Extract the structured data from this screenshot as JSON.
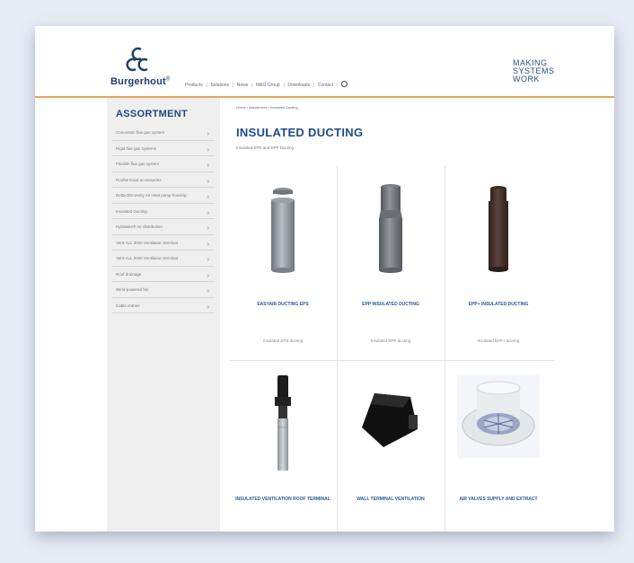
{
  "header": {
    "brand": "Burgerhout",
    "brand_mark": "®",
    "nav": [
      "Products",
      "Solutions",
      "News",
      "M&G Group",
      "Downloads",
      "Contact"
    ],
    "slogan": [
      "MAKING",
      "SYSTEMS",
      "WORK"
    ]
  },
  "sidebar": {
    "title": "ASSORTMENT",
    "items": [
      "Concentric flue gas system",
      "Rigid flue gas systems",
      "Flexible flue gas system",
      "Roofterminal accessories",
      "Delta-Discovery Air Heat pump housing",
      "Insulated Ducting",
      "Hybalaire® Air distribution",
      "Vent-ALL 3000 Ventilation terminal",
      "Vent-ALL 2000 Ventilation terminal",
      "Roof drainage",
      "Wind-powered fan",
      "Cable entries"
    ]
  },
  "breadcrumb": "Home › Assortment › Insulated Ducting",
  "page": {
    "title": "INSULATED DUCTING",
    "subtitle": "Insulated EPS and EPP Ducting"
  },
  "products": [
    {
      "name": "EASYAIR DUCTING EPS",
      "desc": "Insulated EPS ducting",
      "icon": "grey-duct-image"
    },
    {
      "name": "EPP INSULATED DUCTING",
      "desc": "Insulated EPP ducting",
      "icon": "dark-grey-duct-image"
    },
    {
      "name": "EPP+ INSULATED DUCTING",
      "desc": "Insulated EPP+ ducting",
      "icon": "brown-duct-image"
    },
    {
      "name": "INSULATED VENTILATION ROOF TERMINAL",
      "desc": "",
      "icon": "roof-terminal-image"
    },
    {
      "name": "WALL TERMINAL VENTILATION",
      "desc": "",
      "icon": "wall-terminal-image"
    },
    {
      "name": "AIR VALVES SUPPLY AND EXTRACT",
      "desc": "",
      "icon": "air-valve-image"
    }
  ],
  "colors": {
    "background": "#e7ecf6",
    "brand_blue": "#1f4b88",
    "accent_orange": "#e8a455",
    "sidebar_bg": "#efefef"
  }
}
